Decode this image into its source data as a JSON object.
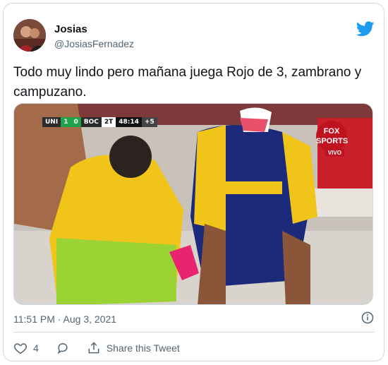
{
  "tweet": {
    "author": {
      "name": "Josias",
      "handle": "@JosiasFernadez",
      "avatar_icon": "profile-photo"
    },
    "text": "Todo muy lindo pero mañana juega Rojo de 3, zambrano y campuzano.",
    "timestamp": "11:51 PM · Aug 3, 2021",
    "media": {
      "scorebug": {
        "home": "UNI",
        "home_score": "1",
        "away_score": "0",
        "away": "BOC",
        "period": "2T",
        "clock": "48:14",
        "added": "+5"
      },
      "broadcaster": "FOX SPORTS",
      "live_label": "VIVO"
    },
    "actions": {
      "like_count": "4",
      "share_label": "Share this Tweet"
    }
  },
  "colors": {
    "brand": "#1d9bf0",
    "muted": "#536471",
    "border": "#cfd9de",
    "text": "#0f1419"
  }
}
